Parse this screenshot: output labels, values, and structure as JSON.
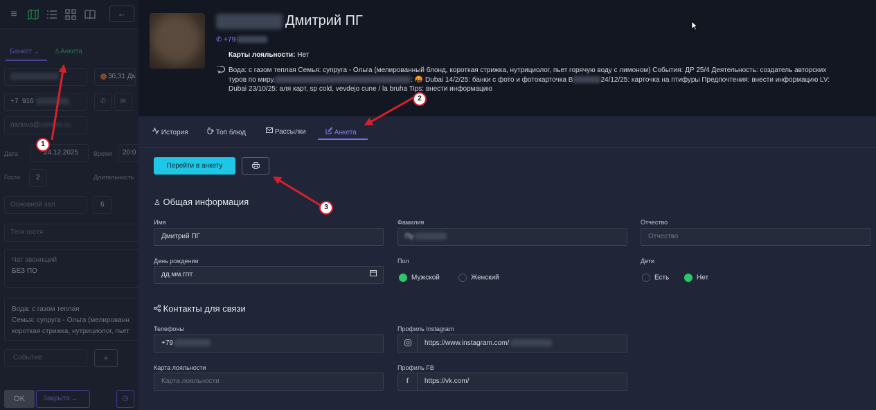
{
  "left_panel": {
    "tabs": {
      "banquet": "Банкет",
      "profile": "Анкета"
    },
    "phone_prefix": "+7",
    "phone_partial": "916",
    "email_partial": "nanova@",
    "email_suffix": "yandex.ru",
    "guest_chip": "30,31 Дм",
    "date_label": "Дата",
    "date_value": "24.12.2025",
    "time_label": "Время",
    "time_value": "20:0",
    "guests_label": "Гости",
    "guests_value": "2",
    "duration_label": "Длительность",
    "hall_placeholder": "Основной зал",
    "hall_number": "6",
    "tags_placeholder": "Теги гостя",
    "chat_label": "Чат звонящий",
    "chat_value": "БЕЗ ПО",
    "notes_lines": [
      "Вода: с газом теплая",
      "Семья: супруга - Ольга (мелированн",
      "короткая стрижка, нутрициолог, пьет"
    ],
    "event_placeholder": "Событие",
    "plus_label": "+",
    "ok_label": "OK",
    "status_label": "Закрыта"
  },
  "header": {
    "name": "Дмитрий ПГ",
    "phone": "+79",
    "loyalty_label": "Карты лояльности:",
    "loyalty_value": "Нет",
    "notes_line1": "Вода: с газом теплая Семья: супруга - Ольга (мелированный блонд, короткая стрижка, нутрициолог, пьет горячую воду с лимоном) События: ДР 25/4 Деятельность: создатель авторских",
    "notes_line2a": "туров по миру.",
    "notes_line2b": ": 🤬 Dubai 14/2/25: банки с фото и фотокарточка В",
    "notes_line2c": "24/12/25: карточка на птифуры Предпочтения: внести информацию LV:",
    "notes_line3": "Dubai 23/10/25: аля карт, sp cold, vevdejo cune / la bruha Tips: внести информацию"
  },
  "tabs": [
    {
      "label": "История",
      "icon": "activity-icon"
    },
    {
      "label": "Топ блюд",
      "icon": "cup-icon"
    },
    {
      "label": "Рассылки",
      "icon": "mail-icon"
    },
    {
      "label": "Анкета",
      "icon": "edit-icon"
    }
  ],
  "actions": {
    "goto_label": "Перейти в анкету",
    "print_icon": "printer-icon"
  },
  "general": {
    "title": "Общая информация",
    "first_name_label": "Имя",
    "first_name_value": "Дмитрий ПГ",
    "last_name_label": "Фамилия",
    "last_name_value": "Пу",
    "patronymic_label": "Отчество",
    "patronymic_placeholder": "Отчество",
    "birthday_label": "День рождения",
    "birthday_placeholder": "дд.мм.гггг",
    "gender_label": "Пол",
    "gender_male": "Мужской",
    "gender_female": "Женский",
    "kids_label": "Дети",
    "kids_yes": "Есть",
    "kids_no": "Нет"
  },
  "contacts": {
    "title": "Контакты для связи",
    "phones_label": "Телефоны",
    "phones_value": "+79",
    "instagram_label": "Профиль Instagram",
    "instagram_value": "https://www.instagram.com/",
    "loyalty_label": "Карта лояльности",
    "loyalty_placeholder": "Карта лояльности",
    "fb_label": "Профиль FB",
    "fb_value": "https://vk.com/"
  },
  "annotations": [
    {
      "number": "1"
    },
    {
      "number": "2"
    },
    {
      "number": "3"
    }
  ],
  "colors": {
    "accent": "#8b7cf8",
    "primary_button": "#1ec7e6",
    "radio_on": "#29c86b",
    "annotation": "#d9202a"
  }
}
